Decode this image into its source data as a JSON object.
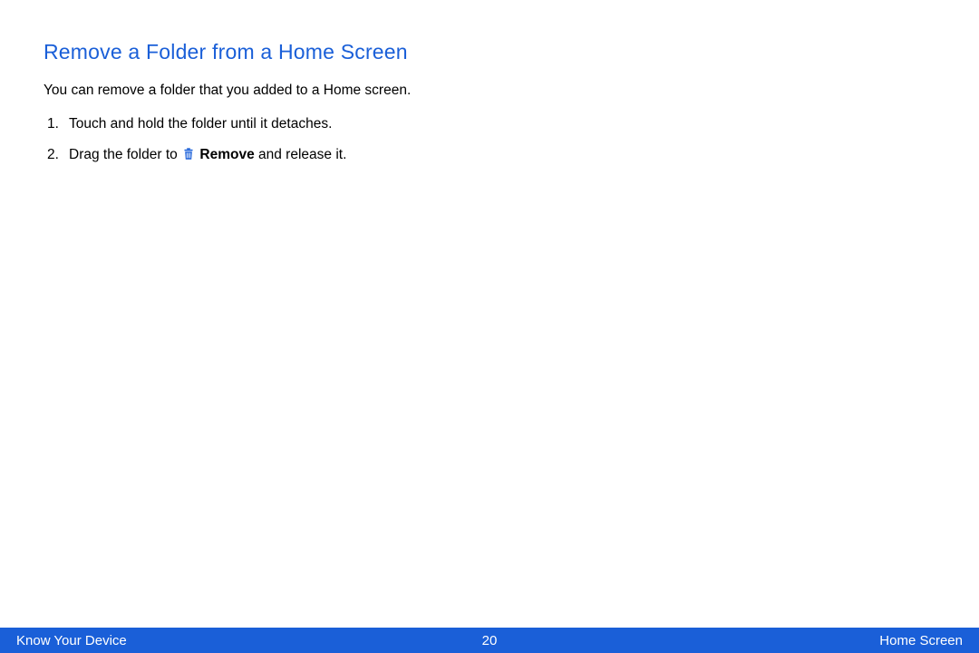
{
  "heading": "Remove a Folder from a Home Screen",
  "intro": "You can remove a folder that you added to a Home screen.",
  "steps": {
    "step1": "Touch and hold the folder until it detaches.",
    "step2_prefix": "Drag the folder to ",
    "step2_bold": "Remove",
    "step2_suffix": " and release it."
  },
  "footer": {
    "left": "Know Your Device",
    "center": "20",
    "right": "Home Screen"
  }
}
